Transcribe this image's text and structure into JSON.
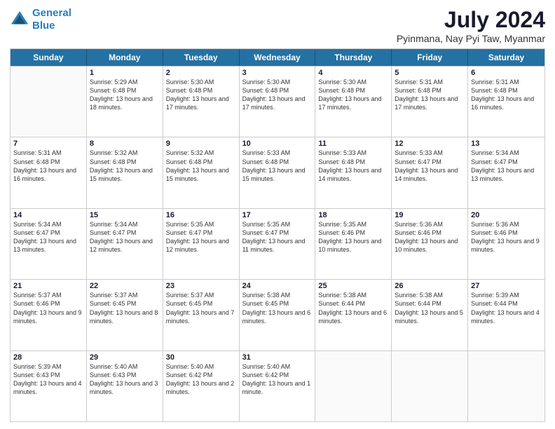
{
  "header": {
    "logo_line1": "General",
    "logo_line2": "Blue",
    "title": "July 2024",
    "subtitle": "Pyinmana, Nay Pyi Taw, Myanmar"
  },
  "days": [
    "Sunday",
    "Monday",
    "Tuesday",
    "Wednesday",
    "Thursday",
    "Friday",
    "Saturday"
  ],
  "weeks": [
    [
      {
        "day": "",
        "sunrise": "",
        "sunset": "",
        "daylight": ""
      },
      {
        "day": "1",
        "sunrise": "Sunrise: 5:29 AM",
        "sunset": "Sunset: 6:48 PM",
        "daylight": "Daylight: 13 hours and 18 minutes."
      },
      {
        "day": "2",
        "sunrise": "Sunrise: 5:30 AM",
        "sunset": "Sunset: 6:48 PM",
        "daylight": "Daylight: 13 hours and 17 minutes."
      },
      {
        "day": "3",
        "sunrise": "Sunrise: 5:30 AM",
        "sunset": "Sunset: 6:48 PM",
        "daylight": "Daylight: 13 hours and 17 minutes."
      },
      {
        "day": "4",
        "sunrise": "Sunrise: 5:30 AM",
        "sunset": "Sunset: 6:48 PM",
        "daylight": "Daylight: 13 hours and 17 minutes."
      },
      {
        "day": "5",
        "sunrise": "Sunrise: 5:31 AM",
        "sunset": "Sunset: 6:48 PM",
        "daylight": "Daylight: 13 hours and 17 minutes."
      },
      {
        "day": "6",
        "sunrise": "Sunrise: 5:31 AM",
        "sunset": "Sunset: 6:48 PM",
        "daylight": "Daylight: 13 hours and 16 minutes."
      }
    ],
    [
      {
        "day": "7",
        "sunrise": "Sunrise: 5:31 AM",
        "sunset": "Sunset: 6:48 PM",
        "daylight": "Daylight: 13 hours and 16 minutes."
      },
      {
        "day": "8",
        "sunrise": "Sunrise: 5:32 AM",
        "sunset": "Sunset: 6:48 PM",
        "daylight": "Daylight: 13 hours and 15 minutes."
      },
      {
        "day": "9",
        "sunrise": "Sunrise: 5:32 AM",
        "sunset": "Sunset: 6:48 PM",
        "daylight": "Daylight: 13 hours and 15 minutes."
      },
      {
        "day": "10",
        "sunrise": "Sunrise: 5:33 AM",
        "sunset": "Sunset: 6:48 PM",
        "daylight": "Daylight: 13 hours and 15 minutes."
      },
      {
        "day": "11",
        "sunrise": "Sunrise: 5:33 AM",
        "sunset": "Sunset: 6:48 PM",
        "daylight": "Daylight: 13 hours and 14 minutes."
      },
      {
        "day": "12",
        "sunrise": "Sunrise: 5:33 AM",
        "sunset": "Sunset: 6:47 PM",
        "daylight": "Daylight: 13 hours and 14 minutes."
      },
      {
        "day": "13",
        "sunrise": "Sunrise: 5:34 AM",
        "sunset": "Sunset: 6:47 PM",
        "daylight": "Daylight: 13 hours and 13 minutes."
      }
    ],
    [
      {
        "day": "14",
        "sunrise": "Sunrise: 5:34 AM",
        "sunset": "Sunset: 6:47 PM",
        "daylight": "Daylight: 13 hours and 13 minutes."
      },
      {
        "day": "15",
        "sunrise": "Sunrise: 5:34 AM",
        "sunset": "Sunset: 6:47 PM",
        "daylight": "Daylight: 13 hours and 12 minutes."
      },
      {
        "day": "16",
        "sunrise": "Sunrise: 5:35 AM",
        "sunset": "Sunset: 6:47 PM",
        "daylight": "Daylight: 13 hours and 12 minutes."
      },
      {
        "day": "17",
        "sunrise": "Sunrise: 5:35 AM",
        "sunset": "Sunset: 6:47 PM",
        "daylight": "Daylight: 13 hours and 11 minutes."
      },
      {
        "day": "18",
        "sunrise": "Sunrise: 5:35 AM",
        "sunset": "Sunset: 6:46 PM",
        "daylight": "Daylight: 13 hours and 10 minutes."
      },
      {
        "day": "19",
        "sunrise": "Sunrise: 5:36 AM",
        "sunset": "Sunset: 6:46 PM",
        "daylight": "Daylight: 13 hours and 10 minutes."
      },
      {
        "day": "20",
        "sunrise": "Sunrise: 5:36 AM",
        "sunset": "Sunset: 6:46 PM",
        "daylight": "Daylight: 13 hours and 9 minutes."
      }
    ],
    [
      {
        "day": "21",
        "sunrise": "Sunrise: 5:37 AM",
        "sunset": "Sunset: 6:46 PM",
        "daylight": "Daylight: 13 hours and 9 minutes."
      },
      {
        "day": "22",
        "sunrise": "Sunrise: 5:37 AM",
        "sunset": "Sunset: 6:45 PM",
        "daylight": "Daylight: 13 hours and 8 minutes."
      },
      {
        "day": "23",
        "sunrise": "Sunrise: 5:37 AM",
        "sunset": "Sunset: 6:45 PM",
        "daylight": "Daylight: 13 hours and 7 minutes."
      },
      {
        "day": "24",
        "sunrise": "Sunrise: 5:38 AM",
        "sunset": "Sunset: 6:45 PM",
        "daylight": "Daylight: 13 hours and 6 minutes."
      },
      {
        "day": "25",
        "sunrise": "Sunrise: 5:38 AM",
        "sunset": "Sunset: 6:44 PM",
        "daylight": "Daylight: 13 hours and 6 minutes."
      },
      {
        "day": "26",
        "sunrise": "Sunrise: 5:38 AM",
        "sunset": "Sunset: 6:44 PM",
        "daylight": "Daylight: 13 hours and 5 minutes."
      },
      {
        "day": "27",
        "sunrise": "Sunrise: 5:39 AM",
        "sunset": "Sunset: 6:44 PM",
        "daylight": "Daylight: 13 hours and 4 minutes."
      }
    ],
    [
      {
        "day": "28",
        "sunrise": "Sunrise: 5:39 AM",
        "sunset": "Sunset: 6:43 PM",
        "daylight": "Daylight: 13 hours and 4 minutes."
      },
      {
        "day": "29",
        "sunrise": "Sunrise: 5:40 AM",
        "sunset": "Sunset: 6:43 PM",
        "daylight": "Daylight: 13 hours and 3 minutes."
      },
      {
        "day": "30",
        "sunrise": "Sunrise: 5:40 AM",
        "sunset": "Sunset: 6:42 PM",
        "daylight": "Daylight: 13 hours and 2 minutes."
      },
      {
        "day": "31",
        "sunrise": "Sunrise: 5:40 AM",
        "sunset": "Sunset: 6:42 PM",
        "daylight": "Daylight: 13 hours and 1 minute."
      },
      {
        "day": "",
        "sunrise": "",
        "sunset": "",
        "daylight": ""
      },
      {
        "day": "",
        "sunrise": "",
        "sunset": "",
        "daylight": ""
      },
      {
        "day": "",
        "sunrise": "",
        "sunset": "",
        "daylight": ""
      }
    ]
  ]
}
